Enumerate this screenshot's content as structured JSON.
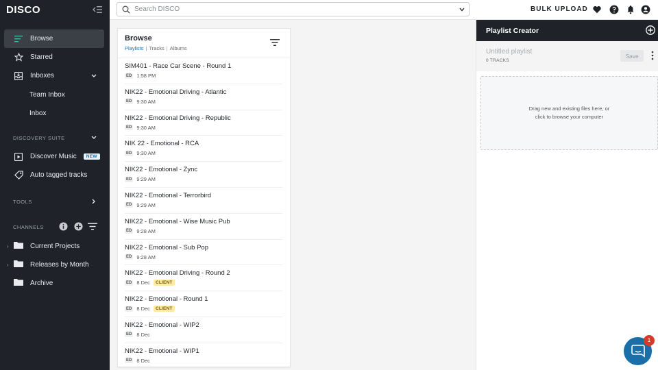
{
  "app": {
    "logo": "DISCO"
  },
  "sidebar": {
    "items": [
      {
        "label": "Browse"
      },
      {
        "label": "Starred"
      },
      {
        "label": "Inboxes"
      }
    ],
    "inbox_subitems": [
      "Team Inbox",
      "Inbox"
    ],
    "discovery_label": "DISCOVERY SUITE",
    "discovery_items": [
      {
        "label": "Discover Music",
        "badge": "NEW"
      },
      {
        "label": "Auto tagged tracks"
      }
    ],
    "tools_label": "TOOLS",
    "channels_label": "CHANNELS",
    "channels": [
      {
        "label": "Current Projects"
      },
      {
        "label": "Releases by Month"
      },
      {
        "label": "Archive"
      }
    ]
  },
  "topbar": {
    "search_placeholder": "Search DISCO",
    "bulk_upload": "BULK UPLOAD"
  },
  "browse": {
    "title": "Browse",
    "tabs": [
      "Playlists",
      "Tracks",
      "Albums"
    ],
    "rows": [
      {
        "title": "SIM401 - Race Car Scene - Round 1",
        "tag": "ED",
        "time": "1:58 PM",
        "client": ""
      },
      {
        "title": "NIK22 - Emotional Driving - Atlantic",
        "tag": "ED",
        "time": "9:30 AM",
        "client": ""
      },
      {
        "title": "NIK22 - Emotional Driving - Republic",
        "tag": "ED",
        "time": "9:30 AM",
        "client": ""
      },
      {
        "title": "NIK 22 - Emotional - RCA",
        "tag": "ED",
        "time": "9:30 AM",
        "client": ""
      },
      {
        "title": "NIK22 - Emotional - Zync",
        "tag": "ED",
        "time": "9:29 AM",
        "client": ""
      },
      {
        "title": "NIK22 - Emotional - Terrorbird",
        "tag": "ED",
        "time": "9:29 AM",
        "client": ""
      },
      {
        "title": "NIK22 - Emotional - Wise Music Pub",
        "tag": "ED",
        "time": "9:28 AM",
        "client": ""
      },
      {
        "title": "NIK22 - Emotional - Sub Pop",
        "tag": "ED",
        "time": "9:28 AM",
        "client": ""
      },
      {
        "title": "NIK22 - Emotional Driving - Round 2",
        "tag": "ED",
        "time": "8 Dec",
        "client": "CLIENT"
      },
      {
        "title": "NIK22 - Emotional - Round 1",
        "tag": "ED",
        "time": "8 Dec",
        "client": "CLIENT"
      },
      {
        "title": "NIK22 - Emotional - WIP2",
        "tag": "ED",
        "time": "8 Dec",
        "client": ""
      },
      {
        "title": "NIK22 - Emotional - WIP1",
        "tag": "ED",
        "time": "8 Dec",
        "client": ""
      }
    ]
  },
  "playlist_creator": {
    "title": "Playlist Creator",
    "name_placeholder": "Untitled playlist",
    "track_count": "0 TRACKS",
    "save_label": "Save",
    "drop_line1": "Drag new and existing files here, or",
    "drop_line2": "click to browse your computer"
  },
  "chat": {
    "badge": "1"
  },
  "colors": {
    "sidebar": "#1f2329",
    "accent": "#1a73b8",
    "client_badge": "#fdeaa5",
    "chat": "#1a6fa8"
  }
}
